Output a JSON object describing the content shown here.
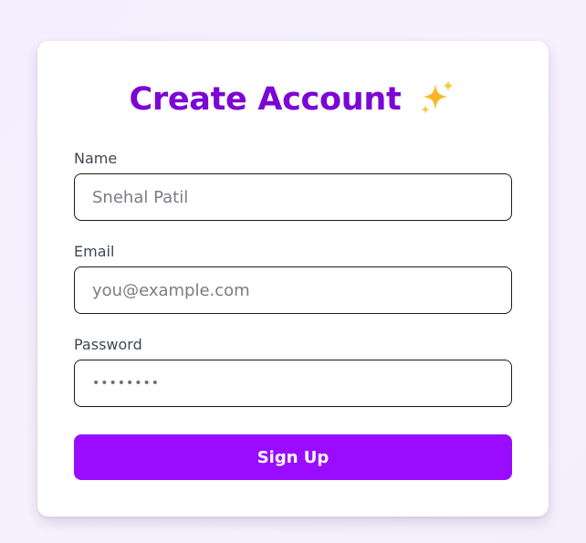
{
  "form": {
    "title": "Create Account",
    "title_icon": "sparkles-icon",
    "fields": [
      {
        "label": "Name",
        "placeholder": "Snehal Patil",
        "value": ""
      },
      {
        "label": "Email",
        "placeholder": "you@example.com",
        "value": ""
      },
      {
        "label": "Password",
        "placeholder": "••••••••",
        "value": ""
      }
    ],
    "submit_label": "Sign Up"
  },
  "colors": {
    "accent": "#9a0cff",
    "title": "#7b06d6",
    "background": "#f4effd",
    "card": "#ffffff",
    "sparkle": "#f6b82b"
  }
}
